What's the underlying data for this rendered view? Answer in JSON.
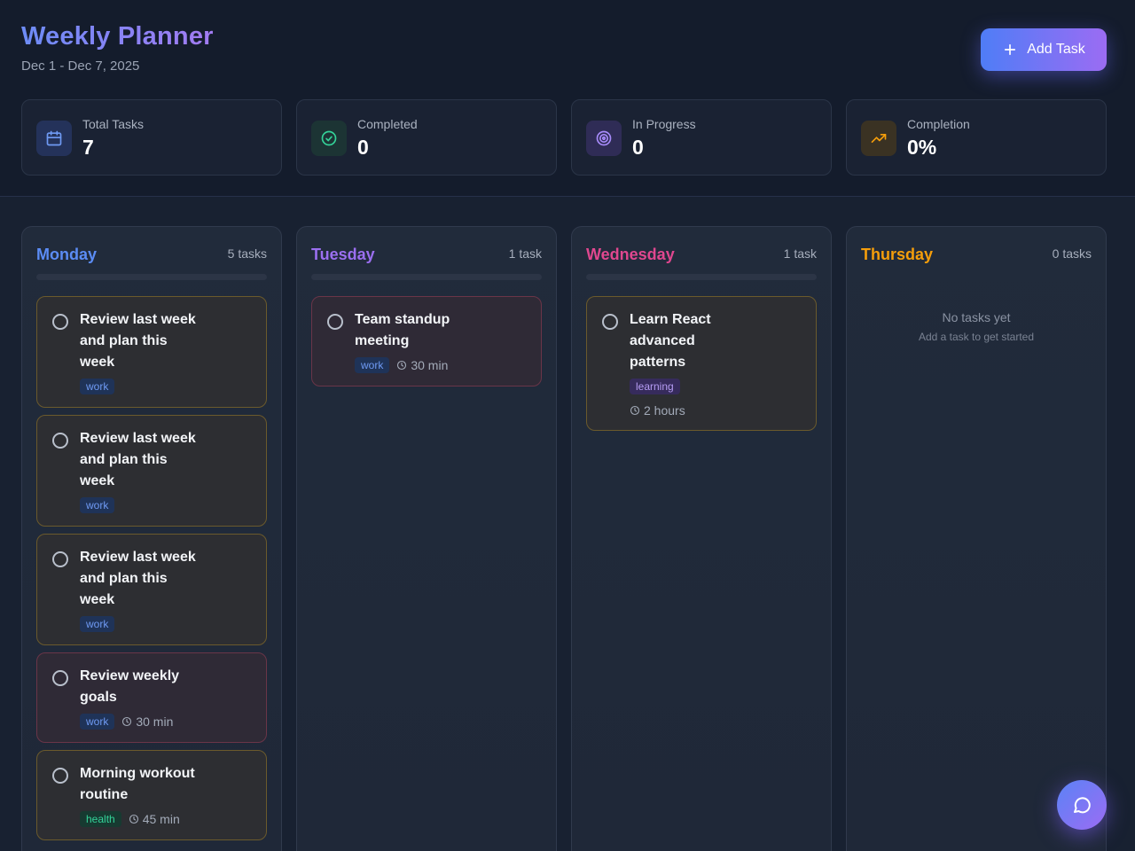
{
  "header": {
    "title": "Weekly Planner",
    "date_range": "Dec 1 - Dec 7, 2025",
    "add_task_label": "Add Task"
  },
  "stats": [
    {
      "label": "Total Tasks",
      "value": "7",
      "icon": "calendar-icon",
      "color": "#6f9af4"
    },
    {
      "label": "Completed",
      "value": "0",
      "icon": "check-circle-icon",
      "color": "#34d399"
    },
    {
      "label": "In Progress",
      "value": "0",
      "icon": "target-icon",
      "color": "#a78bfa"
    },
    {
      "label": "Completion",
      "value": "0%",
      "icon": "trending-up-icon",
      "color": "#f59e0b"
    }
  ],
  "days": [
    {
      "name": "Monday",
      "count": "5 tasks",
      "color": "#5b8cf5",
      "tasks": [
        {
          "title": "Review last week and plan this week",
          "tag": "work",
          "duration": ""
        },
        {
          "title": "Review last week and plan this week",
          "tag": "work",
          "duration": ""
        },
        {
          "title": "Review last week and plan this week",
          "tag": "work",
          "duration": ""
        },
        {
          "title": "Review weekly goals",
          "tag": "work",
          "duration": "30 min"
        },
        {
          "title": "Morning workout routine",
          "tag": "health",
          "duration": "45 min"
        }
      ]
    },
    {
      "name": "Tuesday",
      "count": "1 task",
      "color": "#9b6ff0",
      "tasks": [
        {
          "title": "Team standup meeting",
          "tag": "work",
          "duration": "30 min"
        }
      ]
    },
    {
      "name": "Wednesday",
      "count": "1 task",
      "color": "#e0478f",
      "tasks": [
        {
          "title": "Learn React advanced patterns",
          "tag": "learning",
          "duration": "2 hours"
        }
      ]
    },
    {
      "name": "Thursday",
      "count": "0 tasks",
      "color": "#f59e0b",
      "tasks": [],
      "empty_title": "No tasks yet",
      "empty_subtitle": "Add a task to get started"
    }
  ],
  "colors": {
    "accent_blue": "#4f7df6",
    "accent_purple": "#9b6cf3",
    "background": "#182131"
  }
}
